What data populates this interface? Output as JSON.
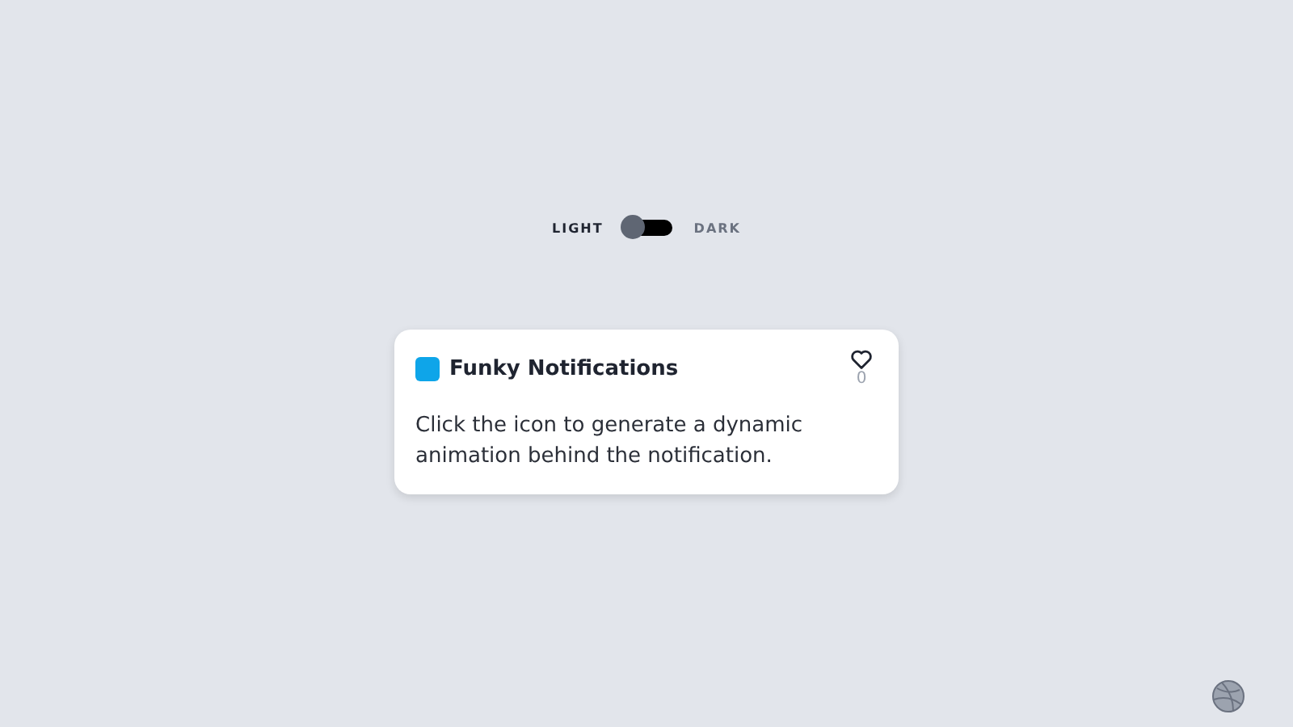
{
  "theme_toggle": {
    "label_left": "LIGHT",
    "label_right": "DARK",
    "on": false
  },
  "card": {
    "title": "Funky Notifications",
    "color": "#0ea5e9",
    "likes": "0",
    "liked": false,
    "body": "Click the icon to generate a dynamic animation behind the notification."
  }
}
